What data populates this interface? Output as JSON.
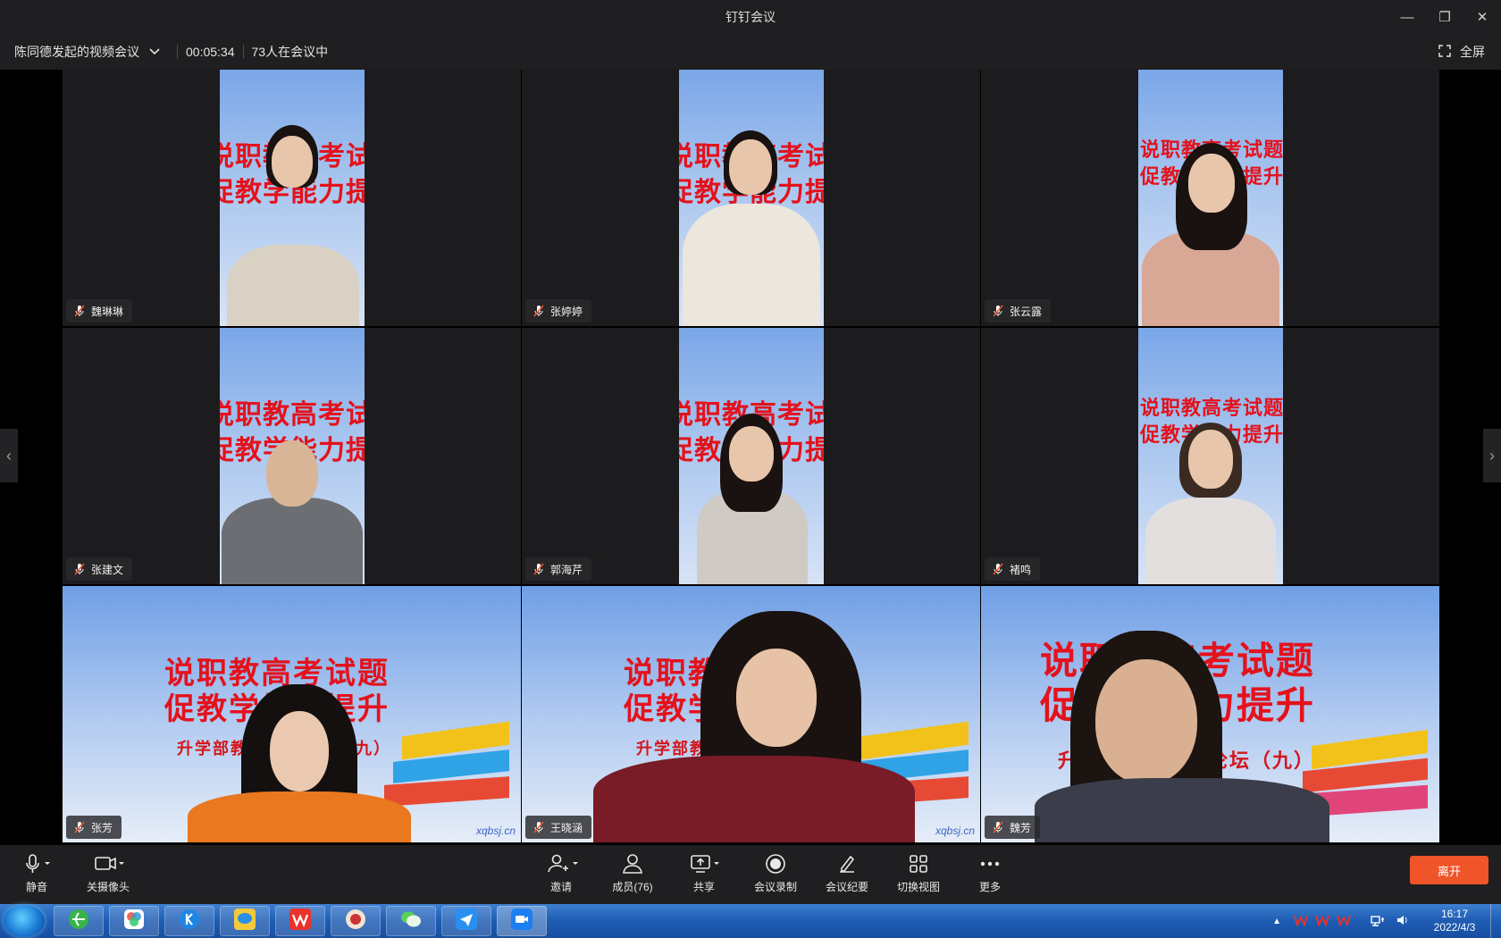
{
  "window": {
    "title": "钉钉会议",
    "minimize_glyph": "—",
    "restore_glyph": "❐",
    "close_glyph": "✕"
  },
  "meeting": {
    "name": "陈同德发起的视频会议",
    "elapsed": "00:05:34",
    "participants_status": "73人在会议中",
    "fullscreen_label": "全屏"
  },
  "banner": {
    "line1": "说职教高考试题",
    "line2": "促教学能力提升",
    "sub": "升学部教育教学论坛（九）",
    "watermark": "xqbsj.cn"
  },
  "participants": [
    {
      "name": "魏琳琳"
    },
    {
      "name": "张婷婷"
    },
    {
      "name": "张云露"
    },
    {
      "name": "张建文"
    },
    {
      "name": "郭海芹"
    },
    {
      "name": "褚鸣"
    },
    {
      "name": "张芳"
    },
    {
      "name": "王晓涵"
    },
    {
      "name": "魏芳"
    }
  ],
  "toolbar": {
    "mute": "静音",
    "camera": "关摄像头",
    "invite": "邀请",
    "members": "成员(76)",
    "share": "共享",
    "record": "会议录制",
    "minutes": "会议纪要",
    "switch_view": "切换视图",
    "more": "更多",
    "leave": "离开"
  },
  "taskbar": {
    "time": "16:17",
    "date": "2022/4/3"
  },
  "colors": {
    "leave_button": "#f0552a",
    "banner_red": "#e4121c",
    "taskbar_blue": "#1e5cb3"
  }
}
